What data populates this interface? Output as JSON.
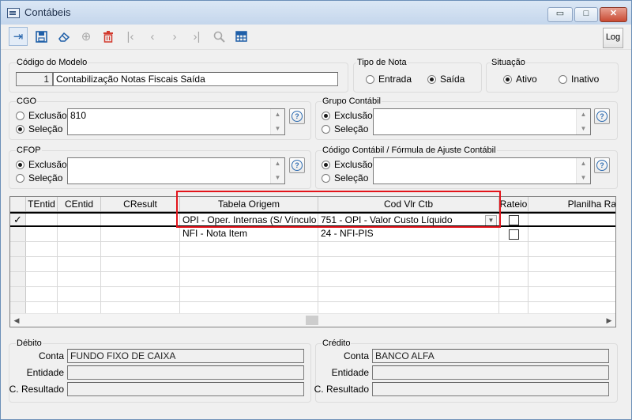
{
  "window": {
    "title": "Contábeis",
    "minimize_label": "▭",
    "maximize_label": "□",
    "close_label": "✕"
  },
  "toolbar": {
    "log_label": "Log"
  },
  "model": {
    "section_label": "Código do Modelo",
    "code": "1",
    "description": "Contabilização Notas Fiscais Saída"
  },
  "tipo_nota": {
    "section_label": "Tipo de Nota",
    "options": [
      "Entrada",
      "Saída"
    ],
    "selected": "Saída"
  },
  "situacao": {
    "section_label": "Situação",
    "options": [
      "Ativo",
      "Inativo"
    ],
    "selected": "Ativo"
  },
  "cgo": {
    "section_label": "CGO",
    "options": [
      "Exclusão",
      "Seleção"
    ],
    "selected": "Seleção",
    "value": "810"
  },
  "grupo_contabil": {
    "section_label": "Grupo Contábil",
    "options": [
      "Exclusão",
      "Seleção"
    ],
    "selected": "Exclusão",
    "value": ""
  },
  "cfop": {
    "section_label": "CFOP",
    "options": [
      "Exclusão",
      "Seleção"
    ],
    "selected": "Exclusão",
    "value": ""
  },
  "codigo_contabil": {
    "section_label": "Código Contábil / Fórmula de Ajuste Contábil",
    "options": [
      "Exclusão",
      "Seleção"
    ],
    "selected": "Exclusão",
    "value": ""
  },
  "grid": {
    "columns": [
      "TEntid",
      "CEntid",
      "CResult",
      "Tabela Origem",
      "Cod Vlr Ctb",
      "Rateio",
      "Planilha Ra"
    ],
    "rows": [
      {
        "tentid": "",
        "centid": "",
        "cresult": "",
        "tabela_origem": "OPI - Oper. Internas (S/ Vínculo NF",
        "cod_vlr_ctb": "751 - OPI - Valor Custo Líquido",
        "rateio": false,
        "current": true
      },
      {
        "tentid": "",
        "centid": "",
        "cresult": "",
        "tabela_origem": "NFI - Nota Item",
        "cod_vlr_ctb": "24 - NFI-PIS",
        "rateio": false,
        "current": false
      }
    ]
  },
  "debito": {
    "section_label": "Débito",
    "conta_label": "Conta",
    "conta": "FUNDO FIXO DE CAIXA",
    "entidade_label": "Entidade",
    "entidade": "",
    "resultado_label": "C. Resultado",
    "resultado": ""
  },
  "credito": {
    "section_label": "Crédito",
    "conta_label": "Conta",
    "conta": "BANCO ALFA",
    "entidade_label": "Entidade",
    "entidade": "",
    "resultado_label": "C. Resultado",
    "resultado": ""
  }
}
